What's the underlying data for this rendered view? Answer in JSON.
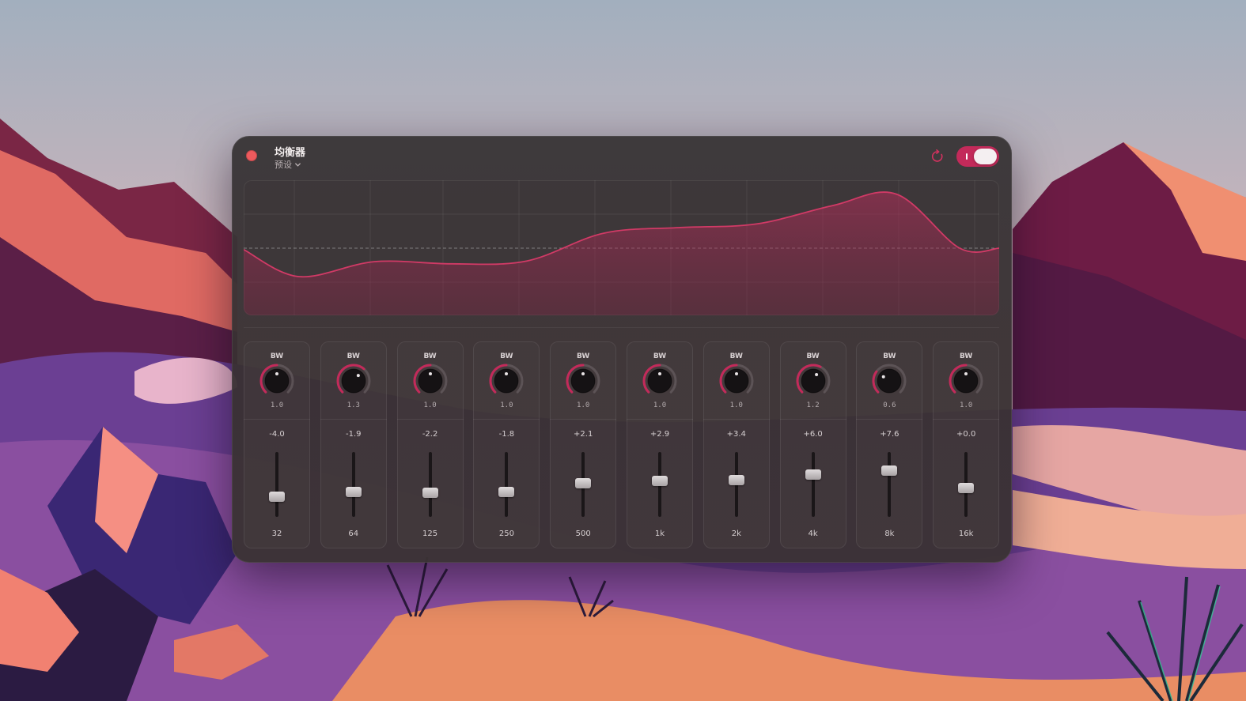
{
  "window": {
    "title": "均衡器",
    "preset_label": "预设",
    "enabled": true
  },
  "colors": {
    "accent": "#c32a5a",
    "curve": "#d13a66",
    "close": "#ee5a5d"
  },
  "bands": [
    {
      "bw_label": "BW",
      "bw": "1.0",
      "gain": "-4.0",
      "gain_value": -4.0,
      "freq": "32"
    },
    {
      "bw_label": "BW",
      "bw": "1.3",
      "gain": "-1.9",
      "gain_value": -1.9,
      "freq": "64"
    },
    {
      "bw_label": "BW",
      "bw": "1.0",
      "gain": "-2.2",
      "gain_value": -2.2,
      "freq": "125"
    },
    {
      "bw_label": "BW",
      "bw": "1.0",
      "gain": "-1.8",
      "gain_value": -1.8,
      "freq": "250"
    },
    {
      "bw_label": "BW",
      "bw": "1.0",
      "gain": "+2.1",
      "gain_value": 2.1,
      "freq": "500"
    },
    {
      "bw_label": "BW",
      "bw": "1.0",
      "gain": "+2.9",
      "gain_value": 2.9,
      "freq": "1k"
    },
    {
      "bw_label": "BW",
      "bw": "1.0",
      "gain": "+3.4",
      "gain_value": 3.4,
      "freq": "2k"
    },
    {
      "bw_label": "BW",
      "bw": "1.2",
      "gain": "+6.0",
      "gain_value": 6.0,
      "freq": "4k"
    },
    {
      "bw_label": "BW",
      "bw": "0.6",
      "gain": "+7.6",
      "gain_value": 7.6,
      "freq": "8k"
    },
    {
      "bw_label": "BW",
      "bw": "1.0",
      "gain": "+0.0",
      "gain_value": 0.0,
      "freq": "16k"
    }
  ],
  "icons": {
    "reset": "reset-icon",
    "preset_dropdown": "chevron-down-icon"
  }
}
